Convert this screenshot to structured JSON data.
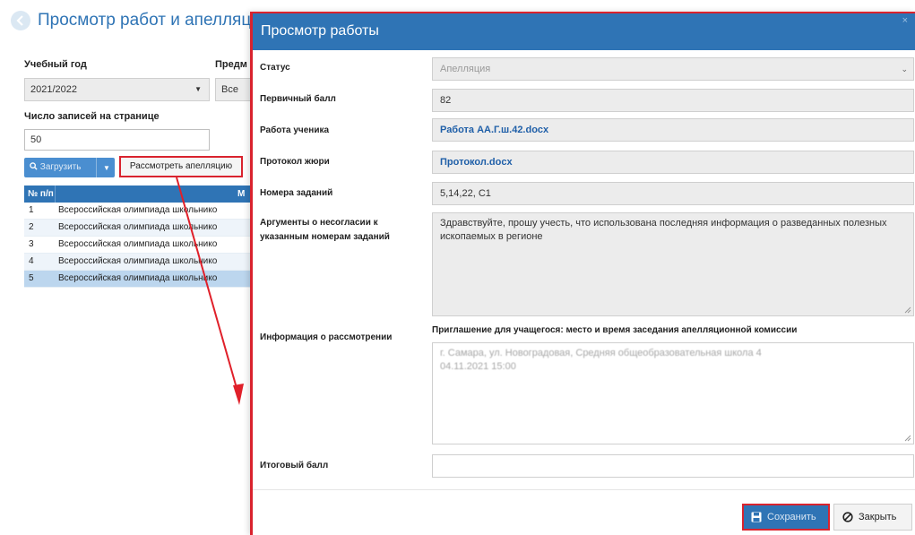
{
  "page": {
    "title": "Просмотр работ и апелляций",
    "school_year_label": "Учебный год",
    "school_year_value": "2021/2022",
    "subject_label": "Предм",
    "subject_value": "Все",
    "per_page_label": "Число записей на странице",
    "per_page_value": "50",
    "load_button": "Загрузить",
    "review_appeal_button": "Рассмотреть апелляцию",
    "table": {
      "col_num": "№ п/п",
      "col_name_partial": "М",
      "rows": [
        {
          "n": "1",
          "name": "Всероссийская олимпиада школьнико"
        },
        {
          "n": "2",
          "name": "Всероссийская олимпиада школьнико"
        },
        {
          "n": "3",
          "name": "Всероссийская олимпиада школьнико"
        },
        {
          "n": "4",
          "name": "Всероссийская олимпиада школьнико"
        },
        {
          "n": "5",
          "name": "Всероссийская олимпиада школьнико"
        }
      ]
    }
  },
  "modal": {
    "title": "Просмотр работы",
    "close_glyph": "×",
    "status_label": "Статус",
    "status_value": "Апелляция",
    "primary_score_label": "Первичный балл",
    "primary_score_value": "82",
    "student_work_label": "Работа ученика",
    "student_work_value": "Работа АА.Г.ш.42.docx",
    "jury_protocol_label": "Протокол жюри",
    "jury_protocol_value": "Протокол.docx",
    "task_numbers_label": "Номера заданий",
    "task_numbers_value": "5,14,22, С1",
    "arguments_label": "Аргументы о несогласии к указанным номерам заданий",
    "arguments_value": "Здравствуйте, прошу учесть, что использована последняя информация о разведанных полезных ископаемых в регионе",
    "review_info_label": "Информация о рассмотрении",
    "invitation_label": "Приглашение для учащегося: место и время заседания апелляционной комиссии",
    "invitation_value_line1": "г. Самара, ул. Новоградовая, Средняя общеобразовательная школа 4",
    "invitation_value_line2": "04.11.2021 15:00",
    "final_score_label": "Итоговый балл",
    "final_score_value": "",
    "save_button": "Сохранить",
    "close_button": "Закрыть"
  },
  "colors": {
    "accent": "#2f74b5",
    "highlight": "#d9232e",
    "field_bg": "#ececec",
    "link": "#1f5fa8"
  },
  "icons": [
    "back-arrow-icon",
    "search-icon",
    "caret-down-icon",
    "chevron-down-icon",
    "close-icon",
    "save-disk-icon",
    "ban-icon",
    "resize-grip-icon"
  ]
}
